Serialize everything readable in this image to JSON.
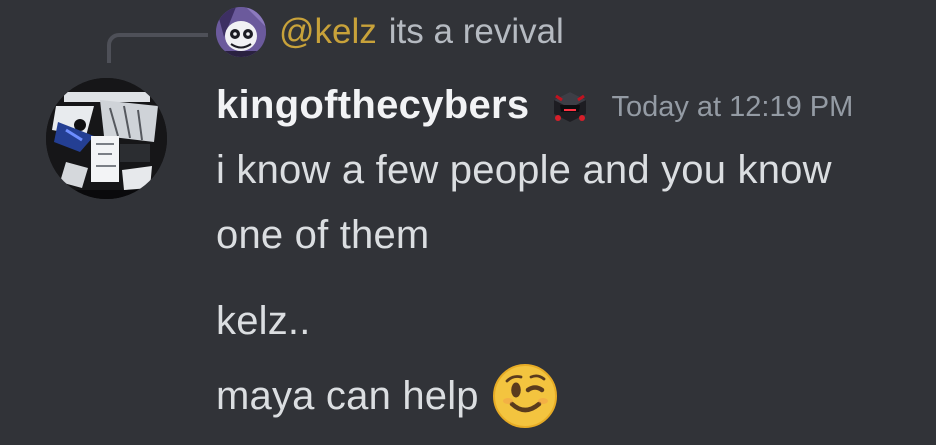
{
  "reply": {
    "author": "@kelz",
    "text": "its a revival"
  },
  "message": {
    "username": "kingofthecybers",
    "timestamp": "Today at 12:19 PM",
    "lines": [
      "i know a few people and you know",
      "one of them",
      "kelz..",
      "maya can help"
    ],
    "emoji": "winking-face-emoji"
  },
  "icons": {
    "reply_avatar": "kelz-avatar",
    "main_avatar": "kingofthecybers-avatar",
    "badge": "roblox-dominus-badge-icon"
  },
  "colors": {
    "background": "#313338",
    "username": "#f2f3f5",
    "mention": "#c8a23a",
    "timestamp": "#949ba4",
    "message_text": "#dbdee1",
    "reply_text": "#b5bac1"
  }
}
